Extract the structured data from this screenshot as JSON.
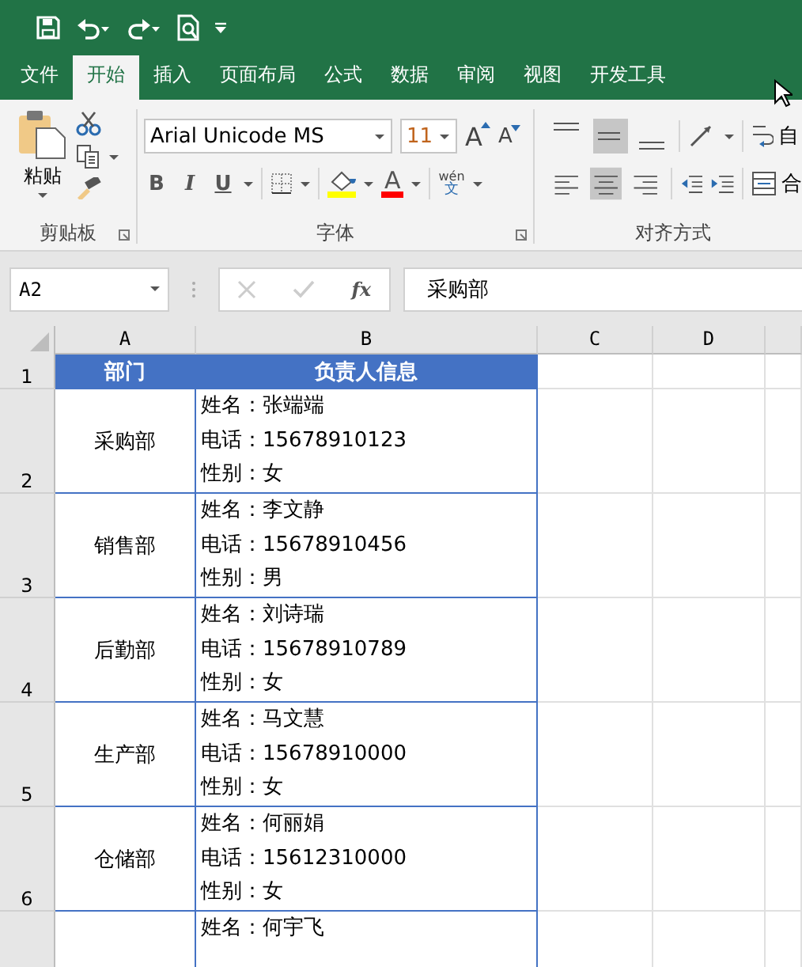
{
  "tabs": [
    {
      "label": "文件",
      "selected": false
    },
    {
      "label": "开始",
      "selected": true
    },
    {
      "label": "插入",
      "selected": false
    },
    {
      "label": "页面布局",
      "selected": false
    },
    {
      "label": "公式",
      "selected": false
    },
    {
      "label": "数据",
      "selected": false
    },
    {
      "label": "审阅",
      "selected": false
    },
    {
      "label": "视图",
      "selected": false
    },
    {
      "label": "开发工具",
      "selected": false
    }
  ],
  "ribbon": {
    "clipboard": {
      "paste_label": "粘贴",
      "group_label": "剪贴板"
    },
    "font": {
      "font_name": "Arial Unicode MS",
      "font_size": "11",
      "grow": "A",
      "shrink": "A",
      "bold": "B",
      "italic": "I",
      "underline": "U",
      "font_color": "A",
      "phonetic_top": "wén",
      "phonetic_bottom": "文",
      "group_label": "字体"
    },
    "alignment": {
      "vertical": [
        {
          "selected": false
        },
        {
          "selected": true
        },
        {
          "selected": false
        }
      ],
      "horizontal": [
        {
          "selected": false
        },
        {
          "selected": true
        },
        {
          "selected": false
        }
      ],
      "wrap_label": "自",
      "merge_label": "合",
      "group_label": "对齐方式"
    }
  },
  "formula_bar": {
    "name_box": "A2",
    "fx": "fx",
    "value": "采购部"
  },
  "sheet": {
    "columns": [
      "A",
      "B",
      "C",
      "D"
    ],
    "header_row": {
      "number": "1",
      "cells": [
        "部门",
        "负责人信息"
      ]
    },
    "rows": [
      {
        "number": "2",
        "department": "采购部",
        "info": [
          "姓名：张端端",
          "电话：15678910123",
          "性别：女"
        ]
      },
      {
        "number": "3",
        "department": "销售部",
        "info": [
          "姓名：李文静",
          "电话：15678910456",
          "性别：男"
        ]
      },
      {
        "number": "4",
        "department": "后勤部",
        "info": [
          "姓名：刘诗瑞",
          "电话：15678910789",
          "性别：女"
        ]
      },
      {
        "number": "5",
        "department": "生产部",
        "info": [
          "姓名：马文慧",
          "电话：15678910000",
          "性别：女"
        ]
      },
      {
        "number": "6",
        "department": "仓储部",
        "info": [
          "姓名：何丽娟",
          "电话：15612310000",
          "性别：女"
        ]
      },
      {
        "info": [
          "姓名：何宇飞"
        ]
      }
    ]
  }
}
